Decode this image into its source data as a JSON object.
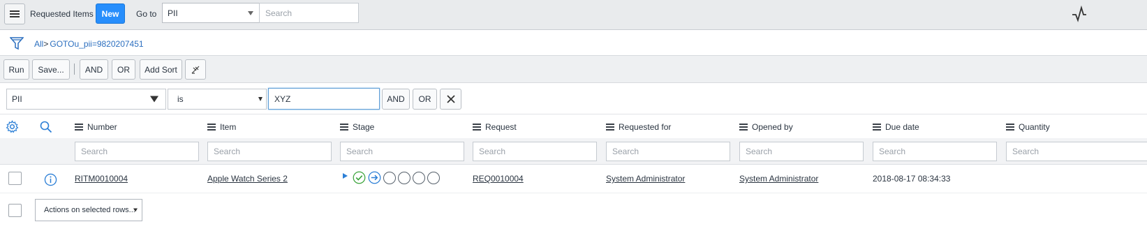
{
  "header": {
    "title": "Requested Items",
    "new_label": "New",
    "goto_label": "Go to",
    "goto_field": "PII",
    "search_placeholder": "Search"
  },
  "breadcrumb": {
    "all_label": "All",
    "separator": ">",
    "filter_label": "GOTOu_pii=9820207451"
  },
  "toolbar": {
    "run": "Run",
    "save": "Save...",
    "and": "AND",
    "or": "OR",
    "add_sort": "Add Sort"
  },
  "condition": {
    "field": "PII",
    "operator": "is",
    "value": "XYZ",
    "and": "AND",
    "or": "OR"
  },
  "columns": [
    "Number",
    "Item",
    "Stage",
    "Request",
    "Requested for",
    "Opened by",
    "Due date",
    "Quantity"
  ],
  "column_search_placeholder": "Search",
  "rows": [
    {
      "number": "RITM0010004",
      "item": "Apple Watch Series 2",
      "request": "REQ0010004",
      "requested_for": "System Administrator",
      "opened_by": "System Administrator",
      "due_date": "2018-08-17 08:34:33",
      "quantity": ""
    }
  ],
  "footer": {
    "actions_label": "Actions on selected rows..."
  },
  "colors": {
    "primary_button": "#278efc",
    "link": "#2c6fbf",
    "stage_complete": "#3aa33a",
    "stage_current": "#2c7fd6"
  }
}
